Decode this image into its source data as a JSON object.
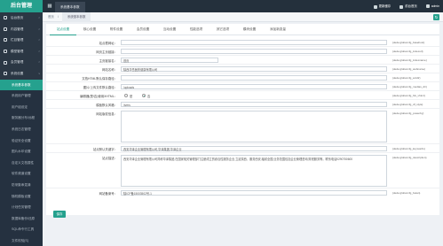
{
  "app": {
    "brand": "后台管理"
  },
  "topbar": {
    "grid_icon": "grid-icon",
    "current_tab": "系统基本参数",
    "links": [
      {
        "icon": "refresh-icon",
        "label": "更新缓存"
      },
      {
        "icon": "home-icon",
        "label": "前台首页"
      },
      {
        "icon": "user-icon",
        "label": "admin"
      }
    ]
  },
  "breadcrumb": {
    "home": "首页",
    "separator": "/",
    "current": "系统基本参数",
    "refresh_icon": "refresh-icon"
  },
  "sidebar": {
    "items": [
      {
        "label": "后台首页",
        "type": "group",
        "icon": "home-icon"
      },
      {
        "label": "内容管理",
        "type": "group",
        "icon": "document-icon"
      },
      {
        "label": "栏目管理",
        "type": "group",
        "icon": "list-icon"
      },
      {
        "label": "模型管理",
        "type": "group",
        "icon": "model-icon"
      },
      {
        "label": "会员管理",
        "type": "group",
        "icon": "user-icon"
      },
      {
        "label": "系统设置",
        "type": "group",
        "icon": "gear-icon"
      },
      {
        "label": "系统基本参数",
        "type": "sub",
        "active": true
      },
      {
        "label": "系统用户管理",
        "type": "sub"
      },
      {
        "label": "用户组设定",
        "type": "sub"
      },
      {
        "label": "服务器分布/远程",
        "type": "sub"
      },
      {
        "label": "系统日志管理",
        "type": "sub"
      },
      {
        "label": "验证安全设置",
        "type": "sub"
      },
      {
        "label": "图片水印设置",
        "type": "sub"
      },
      {
        "label": "自定义文档属性",
        "type": "sub"
      },
      {
        "label": "软件频道设置",
        "type": "sub"
      },
      {
        "label": "防采集串混淆",
        "type": "sub"
      },
      {
        "label": "随机模板设置",
        "type": "sub"
      },
      {
        "label": "计划任务管理",
        "type": "sub"
      },
      {
        "label": "数据库备份/还原",
        "type": "sub"
      },
      {
        "label": "SQL命令行工具",
        "type": "sub"
      },
      {
        "label": "文件校验[S]",
        "type": "sub"
      }
    ]
  },
  "tabs": [
    "站点设置",
    "核心设置",
    "附件设置",
    "会员设置",
    "互动设置",
    "性能选项",
    "其它选项",
    "模块设置",
    "添加新变量"
  ],
  "form": {
    "rows": [
      {
        "label": "站点根网址：",
        "value": "",
        "var": "{dede:global.cfg_basehost}"
      },
      {
        "label": "网页主页链接：",
        "value": "",
        "var": "{dede:global.cfg_indexurl}"
      },
      {
        "label": "主页链接名：",
        "value": "首页",
        "var": "{dede:global.cfg_indexname}"
      },
      {
        "label": "网站名称：",
        "value": "陕西华岳医药健康有限公司",
        "var": "{dede:global.cfg_webname}"
      },
      {
        "label": "文档HTML默认保存路径：",
        "value": "",
        "var": "{dede:global.cfg_arcdir}"
      },
      {
        "label": "图片/上传文件默认路径：",
        "value": "/uploads",
        "var": "{dede:global.cfg_medias_dir}"
      },
      {
        "label": "编辑器(是/否)使用XHTML：",
        "value": "",
        "var": "{dede:global.cfg_fck_xhtml}",
        "radio": {
          "options": [
            "是",
            "否"
          ],
          "selected": 1
        }
      },
      {
        "label": "模板默认风格：",
        "value": "/tvers",
        "var": "{dede:global.cfg_df_style}"
      },
      {
        "label": "网站版权信息：",
        "value": "",
        "var": "{dede:global.cfg_powerby}",
        "textarea": true
      },
      {
        "label": "站点默认关键字：",
        "value": "西安华泽企业管理有限公司,华泽集团,华泽企业",
        "var": "{dede:global.cfg_keywords}"
      },
      {
        "label": "站点描述：",
        "value": "西安华泽企业管理有限公司简称华泽集团,在国家相关管理部门注册成立的综合性服务企业,立足陕西、服务西安,辐射全国,业务范围包括企业管理咨询,财税服务等。联系电话0290750600",
        "var": "{dede:global.cfg_description}",
        "textarea": true
      },
      {
        "label": "网站备案号：",
        "value": "陕ICP备15003502号-1",
        "var": "{dede:global.cfg_beian}"
      }
    ],
    "save_label": "保存"
  }
}
